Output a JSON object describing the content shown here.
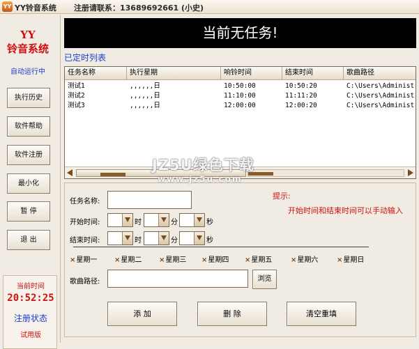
{
  "window": {
    "title": "YY铃音系统",
    "contact": "注册请联系：13689692661 (小史)"
  },
  "sidebar": {
    "logo_line1": "YY",
    "logo_line2": "铃音系统",
    "autorun": "自动运行中",
    "buttons": [
      "执行历史",
      "软件帮助",
      "软件注册",
      "最小化",
      "暂 停",
      "退 出"
    ],
    "current_time_label": "当前时间",
    "current_time": "20:52:25",
    "reg_status": "注册状态",
    "trial": "试用版"
  },
  "banner": "当前无任务!",
  "list_title": "已定时列表",
  "table": {
    "columns": [
      "任务名称",
      "执行星期",
      "响铃时间",
      "结束时间",
      "歌曲路径"
    ],
    "rows": [
      [
        "测试1",
        ",,,,,,日",
        "10:50:00",
        "10:50:20",
        "C:\\Users\\Administr"
      ],
      [
        "测试2",
        ",,,,,,日",
        "11:10:00",
        "11:11:20",
        "C:\\Users\\Administr"
      ],
      [
        "测试3",
        ",,,,,,日",
        "12:00:00",
        "12:00:20",
        "C:\\Users\\Administr"
      ]
    ]
  },
  "form": {
    "task_name_label": "任务名称:",
    "start_label": "开始时间:",
    "end_label": "结束时间:",
    "unit_hour": "时",
    "unit_min": "分",
    "unit_sec": "秒",
    "days": [
      "星期一",
      "星期二",
      "星期三",
      "星期四",
      "星期五",
      "星期六",
      "星期日"
    ],
    "path_label": "歌曲路径:",
    "browse": "浏览",
    "add": "添 加",
    "delete": "删 除",
    "clear": "清空重填",
    "hint_title": "提示:",
    "hint_text": "开始时间和结束时间可以手动输入"
  },
  "watermark": {
    "line1": "JZ5U绿色下载",
    "line2": "www.jz5u.com"
  },
  "colors": {
    "accent_red": "#d01010",
    "accent_blue": "#1a3bd0",
    "banner_bg": "#000000"
  }
}
